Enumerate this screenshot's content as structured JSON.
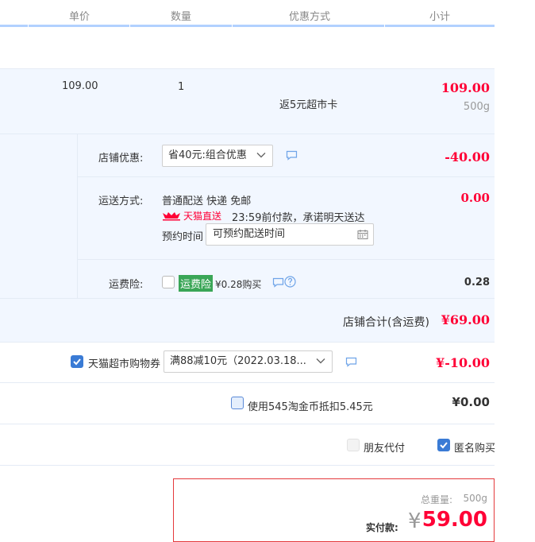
{
  "header": {
    "unit_price": "单价",
    "quantity": "数量",
    "discount_method": "优惠方式",
    "subtotal": "小计"
  },
  "item": {
    "unit_price": "109.00",
    "quantity": "1",
    "promo": "返5元超市卡",
    "subtotal": "109.00",
    "weight": "500g"
  },
  "shop_discount": {
    "label": "店铺优惠:",
    "selected": "省40元:组合优惠",
    "amount": "-40.00"
  },
  "shipping": {
    "label": "运送方式:",
    "method": "普通配送 快递 免邮",
    "tmall_badge": "天猫直送",
    "promise": "23:59前付款，承诺明天送达",
    "reserve_label": "预约时间",
    "reserve_placeholder": "可预约配送时间",
    "amount": "0.00"
  },
  "insurance": {
    "label": "运费险:",
    "badge": "运费险",
    "desc": "¥0.28购买",
    "amount": "0.28"
  },
  "shop_total": {
    "label": "店铺合计(含运费)",
    "amount": "¥69.00"
  },
  "coupon": {
    "label": "天猫超市购物券",
    "selected": "满88减10元（2022.03.18...",
    "amount": "¥-10.00"
  },
  "coin": {
    "label": "使用545淘金币抵扣5.45元",
    "amount": "¥0.00"
  },
  "options": {
    "friend_pay": "朋友代付",
    "anonymous": "匿名购买"
  },
  "pay": {
    "weight_label": "总重量:",
    "weight_value": "500g",
    "actual_label": "实付款:",
    "currency": "¥",
    "amount": "59.00"
  },
  "colors": {
    "price_red": "#ff0036",
    "row_blue": "#f2f7ff",
    "header_border": "#b2d1ff",
    "badge_green": "#3aa657",
    "tmall_red": "#ff0036"
  }
}
